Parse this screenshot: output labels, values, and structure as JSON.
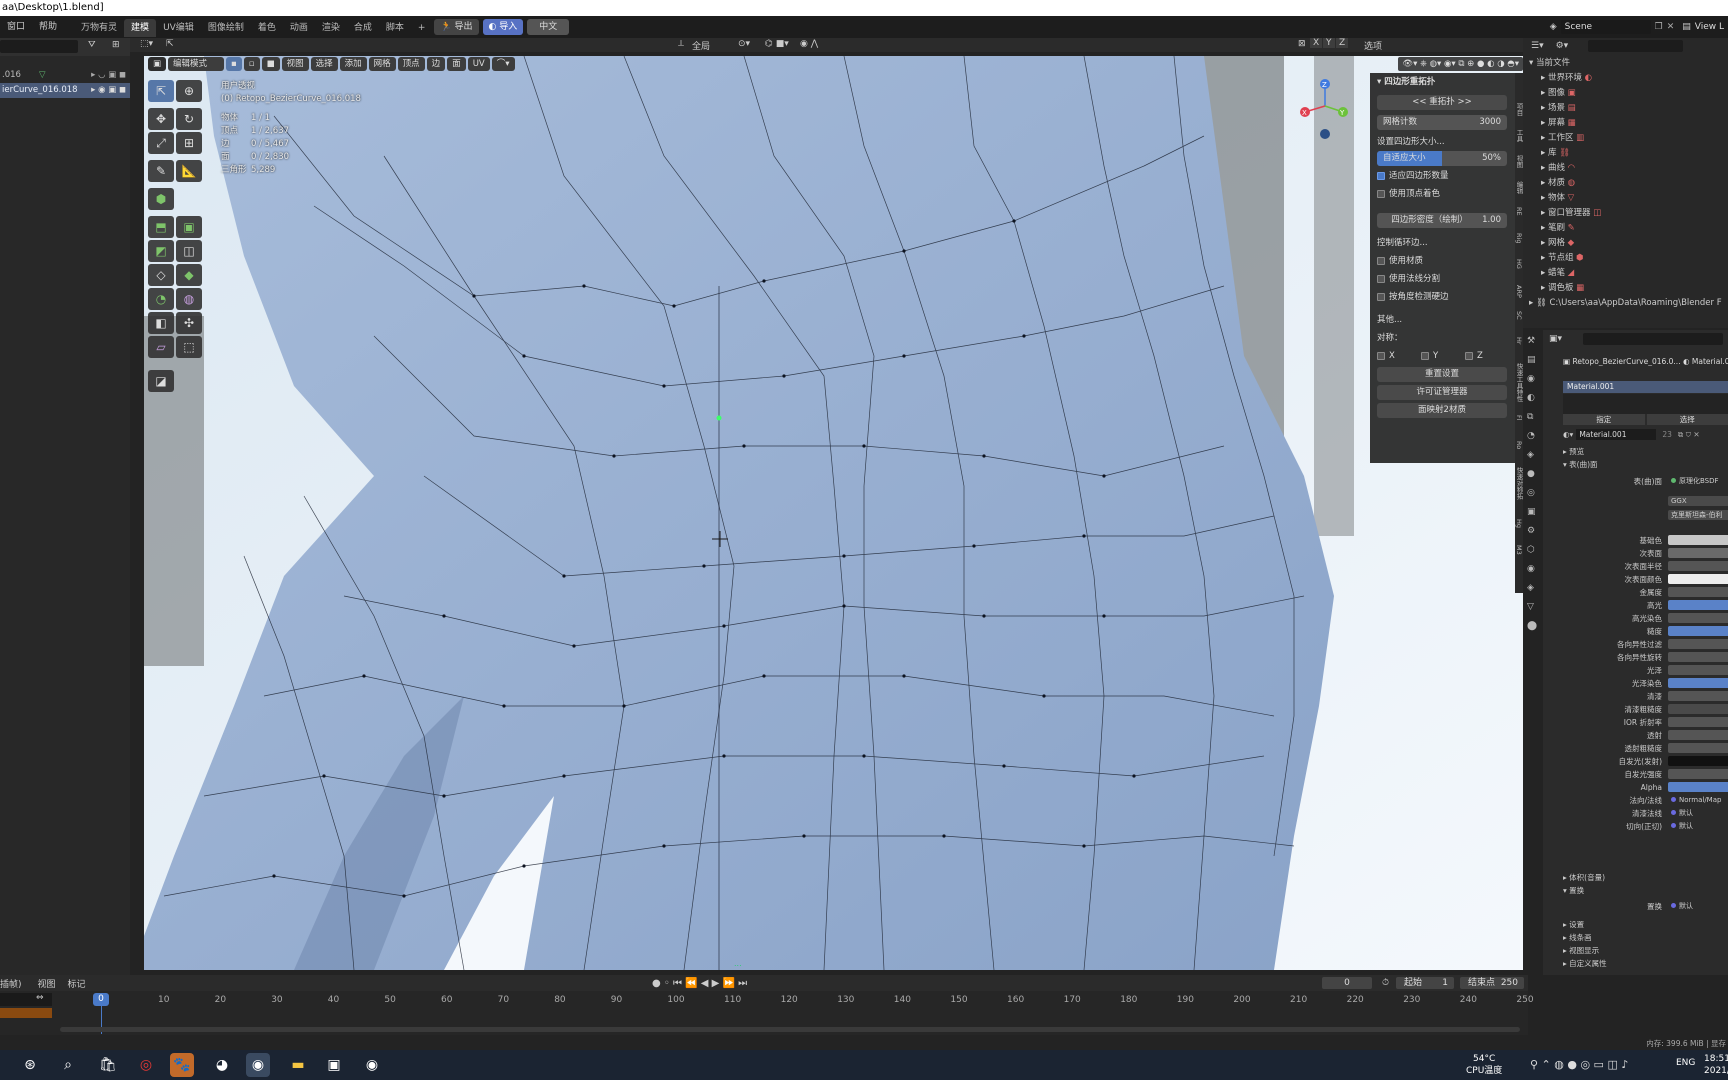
{
  "window": {
    "title": "aa\\Desktop\\1.blend]"
  },
  "menubar": {
    "items": [
      "窗口",
      "帮助"
    ],
    "workspaces": [
      "万物有灵",
      "建模",
      "UV编辑",
      "图像绘制",
      "着色",
      "动画",
      "渲染",
      "合成",
      "脚本"
    ],
    "active_workspace": "建模",
    "plus": "+",
    "export_label": "导出",
    "import_label": "导入",
    "lang_label": "中文",
    "scene_label": "Scene",
    "viewlayer_label": "View L"
  },
  "outliner": {
    "rows": [
      {
        "label": ".016",
        "selected": false
      },
      {
        "label": "ierCurve_016.018",
        "selected": true
      }
    ]
  },
  "viewport": {
    "mode": "编辑模式",
    "menus": [
      "视图",
      "选择",
      "添加",
      "网格",
      "顶点",
      "边",
      "面",
      "UV"
    ],
    "transform": "全局",
    "options": "选项",
    "axes": [
      "X",
      "Y",
      "Z"
    ],
    "view_name": "用户透视",
    "object_name": "(0) Retopo_BezierCurve_016.018",
    "stats": [
      {
        "k": "物体",
        "v": "1 / 1"
      },
      {
        "k": "顶点",
        "v": "1 / 2,637"
      },
      {
        "k": "边",
        "v": "0 / 5,467"
      },
      {
        "k": "面",
        "v": "0 / 2,830"
      },
      {
        "k": "三角形",
        "v": "5,289"
      }
    ],
    "footer_hint": "...",
    "gizmo": {
      "x": "X",
      "y": "Y",
      "z": "Z"
    }
  },
  "quadremesh": {
    "title": "四边形重拓扑",
    "remesh_btn": "<< 重拓扑 >>",
    "mesh_count_label": "网格计数",
    "mesh_count": "3000",
    "set_size_label": "设置四边形大小...",
    "adaptive_label": "自适应大小",
    "adaptive_value": "50%",
    "adaptive_fraction": 0.5,
    "adapt_count_label": "适应四边形数量",
    "adapt_count_checked": true,
    "vertex_color_label": "使用顶点着色",
    "vertex_color_checked": false,
    "density_label": "四边形密度（绘制）",
    "density_value": "1.00",
    "edge_loop_label": "控制循环边...",
    "use_material_label": "使用材质",
    "use_normal_label": "使用法线分割",
    "angle_label": "按角度检测硬边",
    "other_label": "其他...",
    "symmetry_label": "对称：",
    "sym_x": "X",
    "sym_y": "Y",
    "sym_z": "Z",
    "reset_btn": "重置设置",
    "license_btn": "许可证管理器",
    "map_btn": "面映射2材质"
  },
  "nside_tabs": [
    "项目",
    "工具",
    "视图",
    "编辑",
    "RE",
    "Rig",
    "HG",
    "ARP",
    "SC",
    "Hr",
    "快速工具",
    "特性",
    "Fl",
    "Ro",
    "快速对称",
    "拓",
    "Hg",
    "M3"
  ],
  "right_outliner": {
    "header": "当前文件",
    "items": [
      "世界环境",
      "图像",
      "场景",
      "屏幕",
      "工作区",
      "库",
      "曲线",
      "材质",
      "物体",
      "窗口管理器",
      "笔刷",
      "网格",
      "节点组",
      "蜡笔",
      "调色板"
    ],
    "path": "C:\\Users\\aa\\AppData\\Roaming\\Blender F"
  },
  "properties": {
    "object_name": "Retopo_BezierCurve_016.0...",
    "material_tab": "Material.0",
    "slot": "Material.001",
    "assign": "指定",
    "select": "选择",
    "mat_name": "Material.001",
    "users": "23",
    "preview": "预览",
    "surface": "表(曲)面",
    "surface_label": "表(曲)面",
    "surface_value": "原理化BSDF",
    "dist": "GGX",
    "sss_method": "克里斯坦森-伯利",
    "rows": [
      {
        "k": "基础色",
        "v": ""
      },
      {
        "k": "次表面",
        "v": ""
      },
      {
        "k": "次表面半径",
        "v": ""
      },
      {
        "k": "次表面颜色",
        "v": ""
      },
      {
        "k": "金属度",
        "v": ""
      },
      {
        "k": "高光",
        "v": ""
      },
      {
        "k": "高光染色",
        "v": ""
      },
      {
        "k": "糙度",
        "v": ""
      },
      {
        "k": "各向异性过滤",
        "v": ""
      },
      {
        "k": "各向异性旋转",
        "v": ""
      },
      {
        "k": "光泽",
        "v": ""
      },
      {
        "k": "光泽染色",
        "v": ""
      },
      {
        "k": "清漆",
        "v": ""
      },
      {
        "k": "清漆粗糙度",
        "v": ""
      },
      {
        "k": "IOR 折射率",
        "v": ""
      },
      {
        "k": "透射",
        "v": ""
      },
      {
        "k": "透射粗糙度",
        "v": ""
      },
      {
        "k": "自发光(发射)",
        "v": ""
      },
      {
        "k": "自发光强度",
        "v": ""
      },
      {
        "k": "Alpha",
        "v": ""
      },
      {
        "k": "法向/法线",
        "v": "Normal/Map"
      },
      {
        "k": "清漆法线",
        "v": "默认"
      },
      {
        "k": "切向(正切)",
        "v": "默认"
      }
    ],
    "volume": "体积(音量)",
    "displace": "置换",
    "displace_label": "置换",
    "displace_value": "默认",
    "settings": "设置",
    "lineart": "线条画",
    "viewport_display": "视图显示",
    "custom_props": "自定义属性"
  },
  "timeline": {
    "menus": [
      "插帧)",
      "视图",
      "标记"
    ],
    "current_frame": "0",
    "start_label": "起始",
    "start": "1",
    "end_label": "结束点",
    "end": "250",
    "ticks": [
      "10",
      "20",
      "30",
      "40",
      "50",
      "60",
      "70",
      "80",
      "90",
      "100",
      "110",
      "120",
      "130",
      "140",
      "150",
      "160",
      "170",
      "180",
      "190",
      "200",
      "210",
      "220",
      "230",
      "240",
      "250"
    ],
    "playhead": "0",
    "memory": "内存: 399.6 MiB | 显存"
  },
  "taskbar": {
    "temp": "54°C",
    "temp_label": "CPU温度",
    "lang": "ENG",
    "time": "18:51",
    "date": "2021/"
  }
}
